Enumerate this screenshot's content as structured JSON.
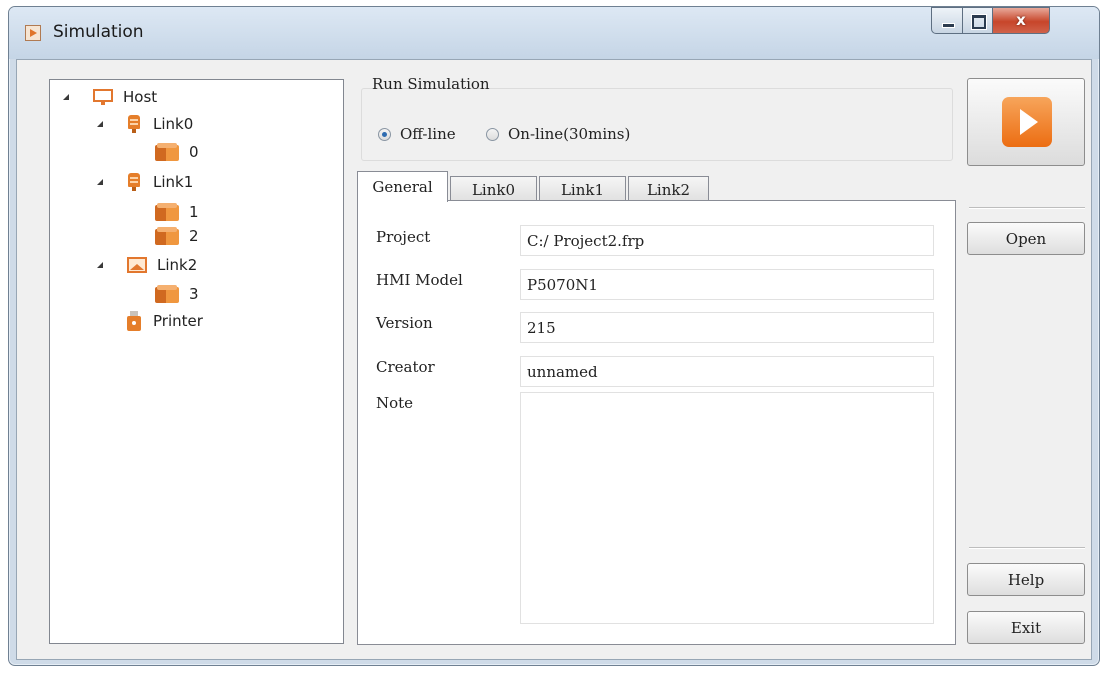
{
  "window": {
    "title": "Simulation",
    "close_glyph": "x"
  },
  "tree": {
    "nodes": [
      {
        "label": "Host",
        "icon": "monitor-icon"
      },
      {
        "label": "Link0",
        "icon": "plug-icon"
      },
      {
        "label": "0",
        "icon": "device-box-icon"
      },
      {
        "label": "Link1",
        "icon": "plug-icon"
      },
      {
        "label": "1",
        "icon": "device-box-icon"
      },
      {
        "label": "2",
        "icon": "device-box-icon"
      },
      {
        "label": "Link2",
        "icon": "network-image-icon"
      },
      {
        "label": "3",
        "icon": "device-box-icon"
      },
      {
        "label": "Printer",
        "icon": "printer-icon"
      }
    ]
  },
  "run_simulation": {
    "label": "Run Simulation",
    "options": [
      {
        "label": "Off-line",
        "selected": true
      },
      {
        "label": "On-line(30mins)",
        "selected": false
      }
    ]
  },
  "tabs": [
    {
      "label": "General",
      "active": true
    },
    {
      "label": "Link0",
      "active": false
    },
    {
      "label": "Link1",
      "active": false
    },
    {
      "label": "Link2",
      "active": false
    }
  ],
  "general": {
    "fields": [
      {
        "label": "Project",
        "value": "C:/ Project2.frp"
      },
      {
        "label": "HMI Model",
        "value": "P5070N1"
      },
      {
        "label": "Version",
        "value": "215"
      },
      {
        "label": "Creator",
        "value": "unnamed"
      }
    ],
    "note_label": "Note",
    "note_value": ""
  },
  "buttons": {
    "play": "play-icon",
    "open": "Open",
    "help": "Help",
    "exit": "Exit"
  },
  "colors": {
    "accent": "#ec6d12",
    "title_bar": "#cfdbe8",
    "client_bg": "#f0f0f0"
  }
}
